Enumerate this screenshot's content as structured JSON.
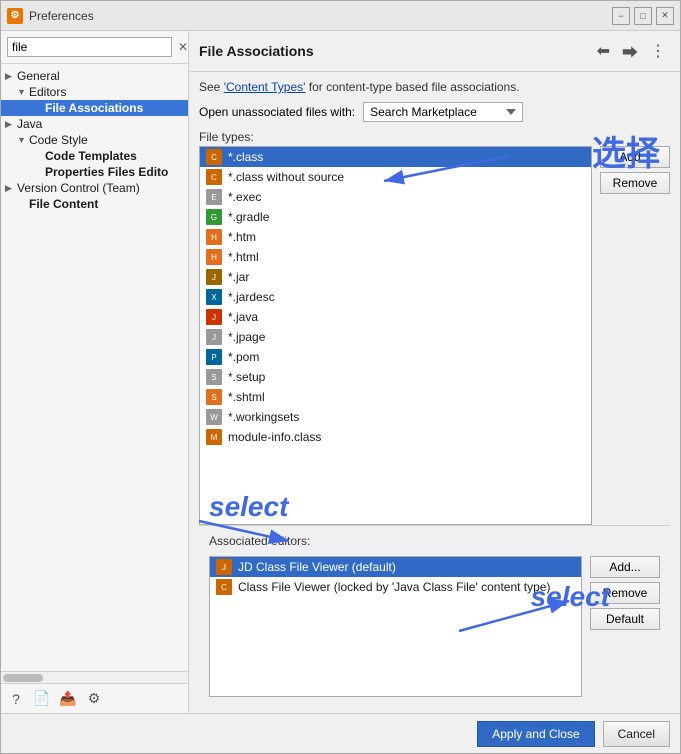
{
  "window": {
    "title": "Preferences",
    "icon": "⚙"
  },
  "titlebar": {
    "minimize_label": "−",
    "maximize_label": "□",
    "close_label": "✕"
  },
  "sidebar": {
    "search_value": "file",
    "search_placeholder": "file",
    "clear_label": "✕",
    "items": [
      {
        "id": "general",
        "label": "General",
        "level": 0,
        "arrow": "▶",
        "expanded": false
      },
      {
        "id": "editors",
        "label": "Editors",
        "level": 1,
        "arrow": "▼",
        "expanded": true
      },
      {
        "id": "file-associations",
        "label": "File Associations",
        "level": 2,
        "selected": true
      },
      {
        "id": "java",
        "label": "Java",
        "level": 0,
        "arrow": "▶"
      },
      {
        "id": "code-style",
        "label": "Code Style",
        "level": 1,
        "arrow": "▼",
        "expanded": true
      },
      {
        "id": "code-templates",
        "label": "Code Templates",
        "level": 2
      },
      {
        "id": "properties-files",
        "label": "Properties Files Edito",
        "level": 2
      },
      {
        "id": "version-control",
        "label": "Version Control (Team)",
        "level": 0,
        "arrow": "▶"
      },
      {
        "id": "file-content",
        "label": "File Content",
        "level": 1
      }
    ],
    "bottom_icons": [
      "?",
      "📄",
      "📤",
      "⚙"
    ]
  },
  "panel": {
    "title": "File Associations",
    "toolbar_buttons": [
      "←",
      "→",
      "⋮"
    ],
    "info_text": "See ",
    "info_link": "'Content Types'",
    "info_text2": " for content-type based file associations.",
    "open_unassoc_label": "Open unassociated files with:",
    "open_unassoc_value": "Search Marketplace",
    "file_types_label": "File types:",
    "file_types": [
      {
        "name": "*.class",
        "icon": "class",
        "selected": true
      },
      {
        "name": "*.class without source",
        "icon": "class"
      },
      {
        "name": "*.exec",
        "icon": "generic"
      },
      {
        "name": "*.gradle",
        "icon": "gradle"
      },
      {
        "name": "*.htm",
        "icon": "html"
      },
      {
        "name": "*.html",
        "icon": "html"
      },
      {
        "name": "*.jar",
        "icon": "jar"
      },
      {
        "name": "*.jardesc",
        "icon": "xml"
      },
      {
        "name": "*.java",
        "icon": "java"
      },
      {
        "name": "*.jpage",
        "icon": "generic"
      },
      {
        "name": "*.pom",
        "icon": "xml"
      },
      {
        "name": "*.setup",
        "icon": "generic"
      },
      {
        "name": "*.shtml",
        "icon": "html"
      },
      {
        "name": "*.workingsets",
        "icon": "generic"
      },
      {
        "name": "module-info.class",
        "icon": "class"
      }
    ],
    "add_label": "Add...",
    "remove_label": "Remove",
    "assoc_editors_label": "Associated editors:",
    "editors": [
      {
        "name": "JD Class File Viewer (default)",
        "icon": "class",
        "selected": true
      },
      {
        "name": "Class File Viewer (locked by 'Java Class File' content type)",
        "icon": "class"
      }
    ],
    "add_editor_label": "Add...",
    "remove_editor_label": "Remove",
    "default_editor_label": "Default"
  },
  "annotations": {
    "chinese_text": "选择",
    "select_text1": "select",
    "select_text2": "select"
  },
  "footer": {
    "apply_close_label": "Apply and Close",
    "cancel_label": "Cancel"
  }
}
